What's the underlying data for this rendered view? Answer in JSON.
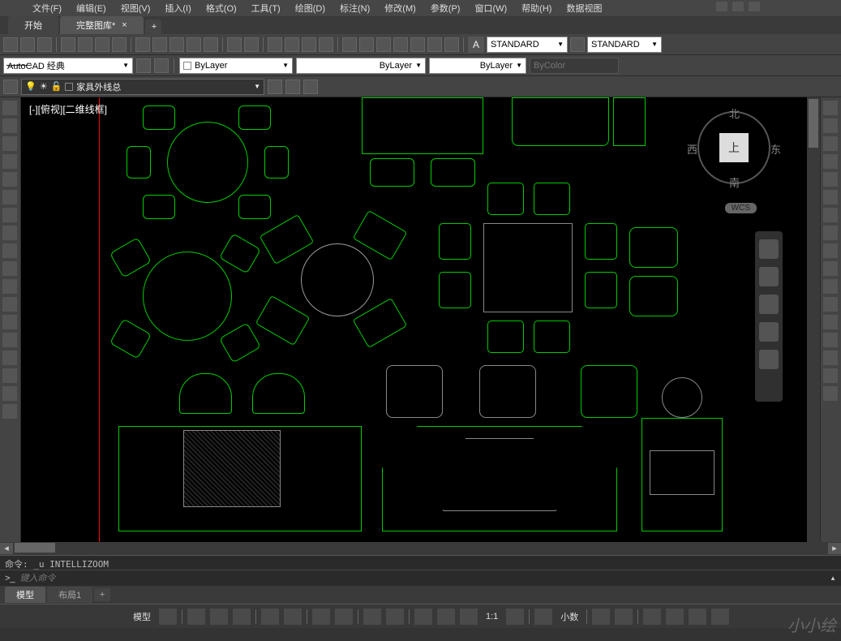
{
  "menu": {
    "items": [
      "文件(F)",
      "编辑(E)",
      "视图(V)",
      "插入(I)",
      "格式(O)",
      "工具(T)",
      "绘图(D)",
      "标注(N)",
      "修改(M)",
      "参数(P)",
      "窗口(W)",
      "帮助(H)",
      "数据视图"
    ]
  },
  "tabs": {
    "t1": "开始",
    "t2": "完整图库*",
    "close": "×",
    "plus": "+"
  },
  "toolbar": {
    "style1": "STANDARD",
    "style2": "STANDARD",
    "workspace": "AutoCAD 经典",
    "bylayer1": "ByLayer",
    "bylayer2": "ByLayer",
    "bylayer3": "ByLayer",
    "bycolor": "ByColor",
    "layername": "家具外线总"
  },
  "canvas": {
    "label": "[-][俯视][二维线框]"
  },
  "viewcube": {
    "top": "上",
    "n": "北",
    "s": "南",
    "e": "东",
    "w": "西",
    "wcs": "WCS"
  },
  "cmd": {
    "out": "命令: _u INTELLIZOOM",
    "prompt": "键入命令",
    "icon": ">_"
  },
  "modeltabs": {
    "model": "模型",
    "layout1": "布局1",
    "plus": "+"
  },
  "status": {
    "model": "模型",
    "ratio": "1:1",
    "dec": "小数",
    "watermark": "小小绘"
  }
}
